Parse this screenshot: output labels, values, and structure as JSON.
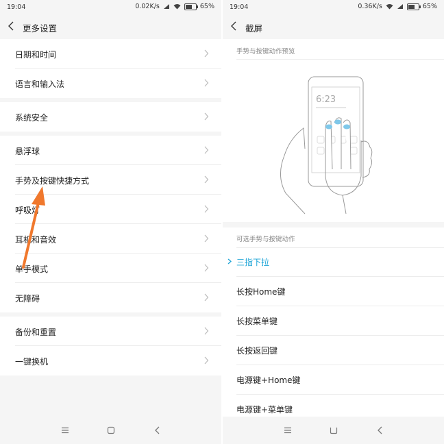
{
  "left": {
    "status": {
      "time": "19:04",
      "speed": "0.02K/s",
      "battery": "65%"
    },
    "title": "更多设置",
    "groups": [
      {
        "items": [
          {
            "label": "日期和时间"
          },
          {
            "label": "语言和输入法"
          }
        ]
      },
      {
        "items": [
          {
            "label": "系统安全"
          }
        ]
      },
      {
        "items": [
          {
            "label": "悬浮球"
          },
          {
            "label": "手势及按键快捷方式"
          },
          {
            "label": "呼吸灯"
          },
          {
            "label": "耳机和音效"
          },
          {
            "label": "单手模式"
          },
          {
            "label": "无障碍"
          }
        ]
      },
      {
        "items": [
          {
            "label": "备份和重置"
          },
          {
            "label": "一键换机"
          }
        ]
      }
    ]
  },
  "right": {
    "status": {
      "time": "19:04",
      "speed": "0.36K/s",
      "battery": "65%"
    },
    "title": "截屏",
    "preview_label": "手势与按键动作预览",
    "phone_time": "6:23",
    "options_label": "可选手势与按键动作",
    "options": [
      {
        "label": "三指下拉",
        "selected": true
      },
      {
        "label": "长按Home键",
        "selected": false
      },
      {
        "label": "长按菜单键",
        "selected": false
      },
      {
        "label": "长按返回键",
        "selected": false
      },
      {
        "label": "电源键+Home键",
        "selected": false
      },
      {
        "label": "电源键+菜单键",
        "selected": false
      }
    ]
  },
  "colors": {
    "accent": "#1aa3d6",
    "annotation_arrow": "#f0782d",
    "background": "#f5f5f5"
  },
  "icons": {
    "back": "chevron-left-icon",
    "row_arrow": "chevron-right-icon",
    "nav_menu": "menu-icon",
    "nav_home": "home-icon",
    "nav_back": "back-icon"
  },
  "battery_level": 0.65
}
